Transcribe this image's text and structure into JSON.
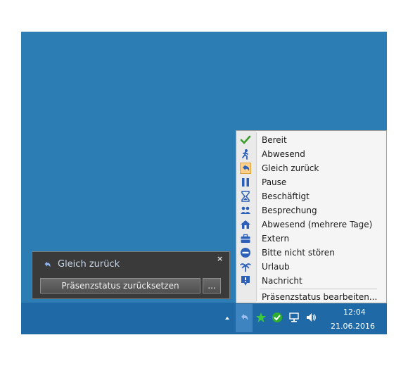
{
  "menu": {
    "items": [
      {
        "label": "Bereit",
        "icon": "check-icon"
      },
      {
        "label": "Abwesend",
        "icon": "running-person-icon"
      },
      {
        "label": "Gleich zurück",
        "icon": "return-arrow-icon",
        "selected": true
      },
      {
        "label": "Pause",
        "icon": "pause-icon"
      },
      {
        "label": "Beschäftigt",
        "icon": "hourglass-icon"
      },
      {
        "label": "Besprechung",
        "icon": "people-icon"
      },
      {
        "label": "Abwesend (mehrere Tage)",
        "icon": "home-icon"
      },
      {
        "label": "Extern",
        "icon": "briefcase-icon"
      },
      {
        "label": "Bitte nicht stören",
        "icon": "do-not-disturb-icon"
      },
      {
        "label": "Urlaub",
        "icon": "palm-tree-icon"
      },
      {
        "label": "Nachricht",
        "icon": "message-icon"
      }
    ],
    "edit_label": "Präsenzstatus bearbeiten..."
  },
  "toast": {
    "title": "Gleich zurück",
    "close": "×",
    "reset_button": "Präsenzstatus zurücksetzen",
    "more_button": "..."
  },
  "tray": {
    "time": "12:04",
    "date": "21.06.2016"
  },
  "colors": {
    "desktop": "#2d7db5",
    "taskbar": "#1f6aa6",
    "selected_icon_bg": "#ffd08a",
    "presence_blue": "#2b5fb8"
  }
}
